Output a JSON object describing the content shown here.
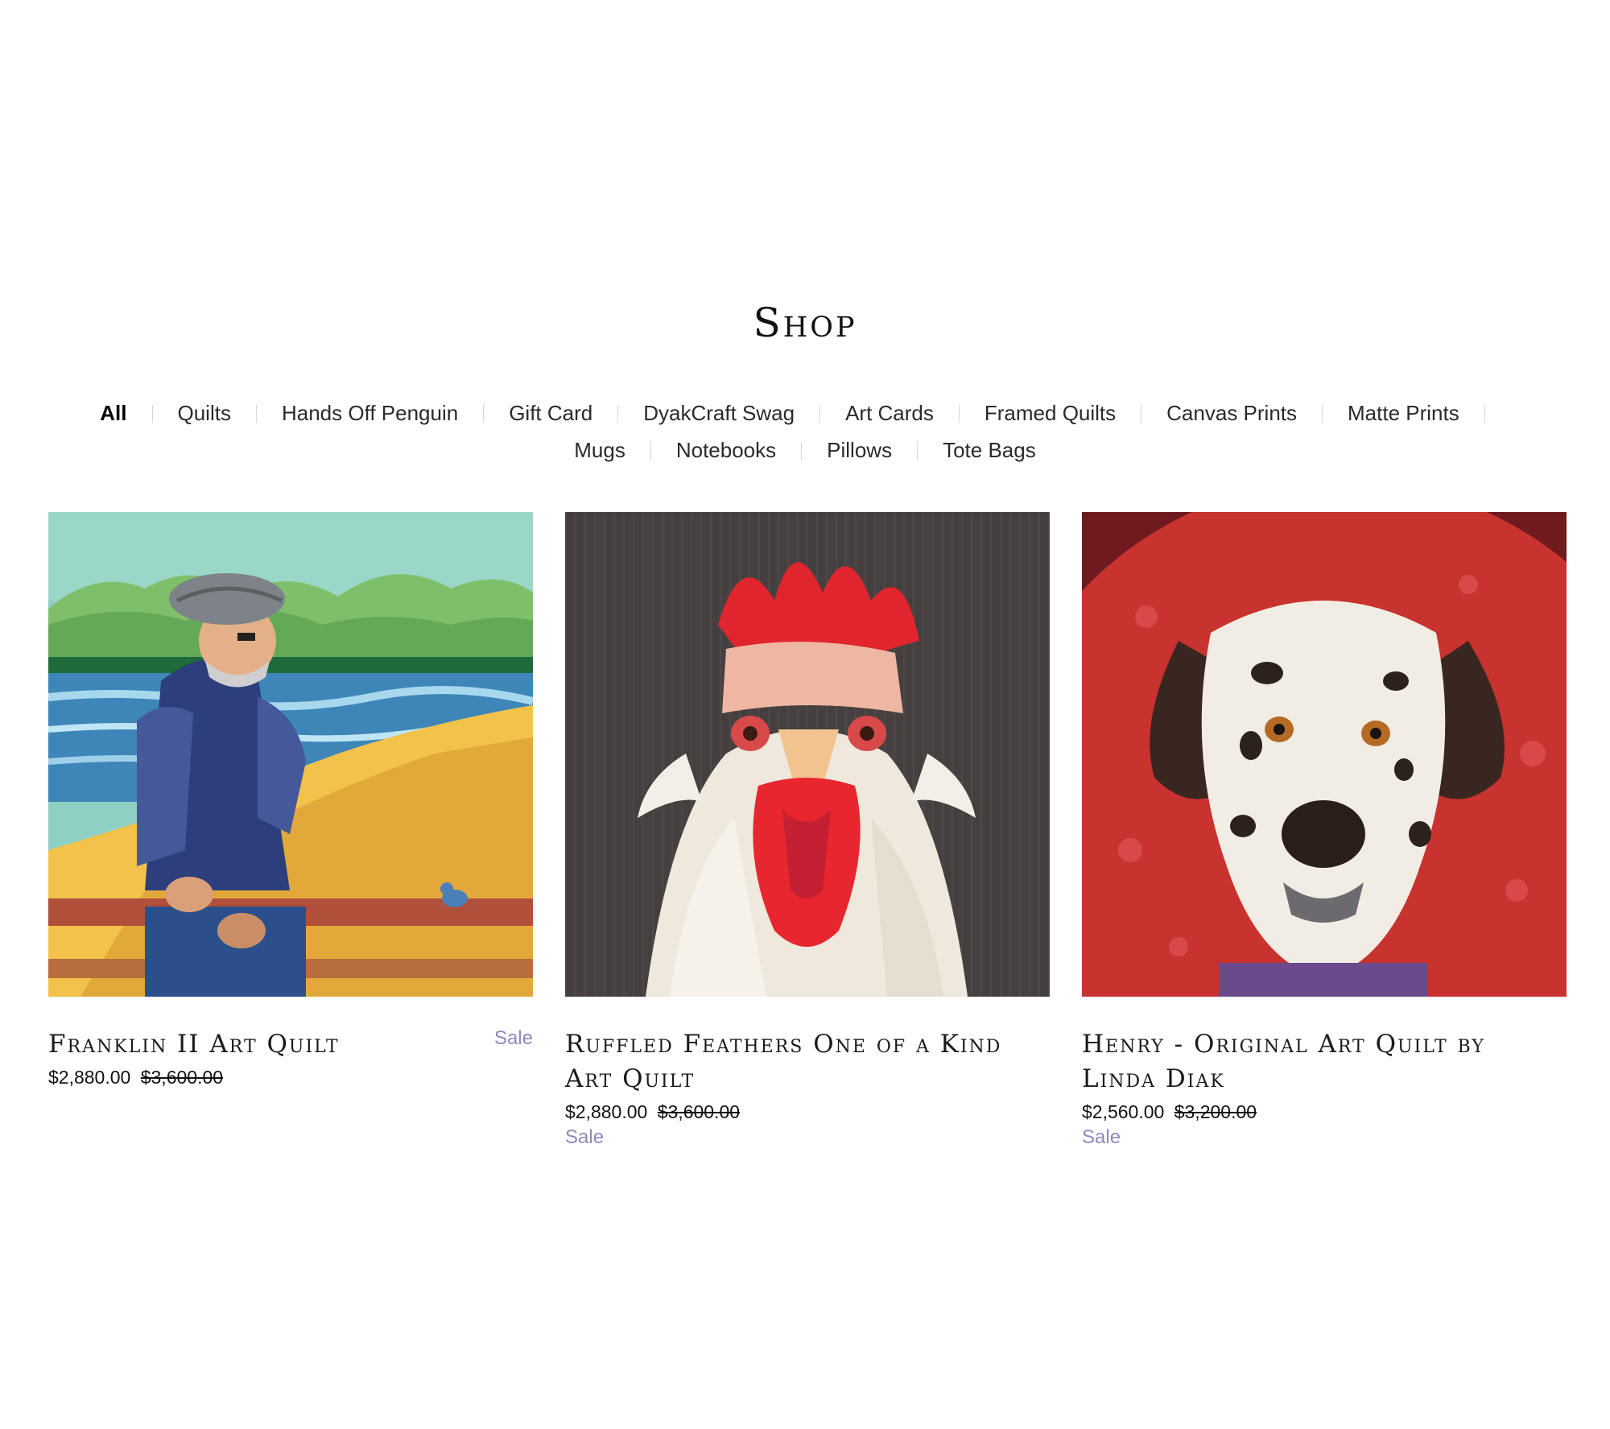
{
  "page": {
    "title": "Shop"
  },
  "categories": {
    "row1": [
      "All",
      "Quilts",
      "Hands Off Penguin",
      "Gift Card",
      "DyakCraft Swag",
      "Art Cards",
      "Framed Quilts",
      "Canvas Prints",
      "Matte Prints"
    ],
    "row2": [
      "Mugs",
      "Notebooks",
      "Pillows",
      "Tote Bags"
    ],
    "active": "All"
  },
  "products": [
    {
      "title": "Franklin II Art Quilt",
      "price": "$2,880.00",
      "compare_price": "$3,600.00",
      "sale_label": "Sale",
      "image_icon": "man-in-rowboat-quilt-image"
    },
    {
      "title": "Ruffled Feathers One of a Kind Art Quilt",
      "price": "$2,880.00",
      "compare_price": "$3,600.00",
      "sale_label": "Sale",
      "image_icon": "rooster-quilt-image"
    },
    {
      "title": "Henry - Original Art Quilt by Linda Diak",
      "price": "$2,560.00",
      "compare_price": "$3,200.00",
      "sale_label": "Sale",
      "image_icon": "dalmatian-quilt-image"
    }
  ],
  "colors": {
    "sale": "#8a8ac0",
    "text": "#1a1a1a"
  }
}
